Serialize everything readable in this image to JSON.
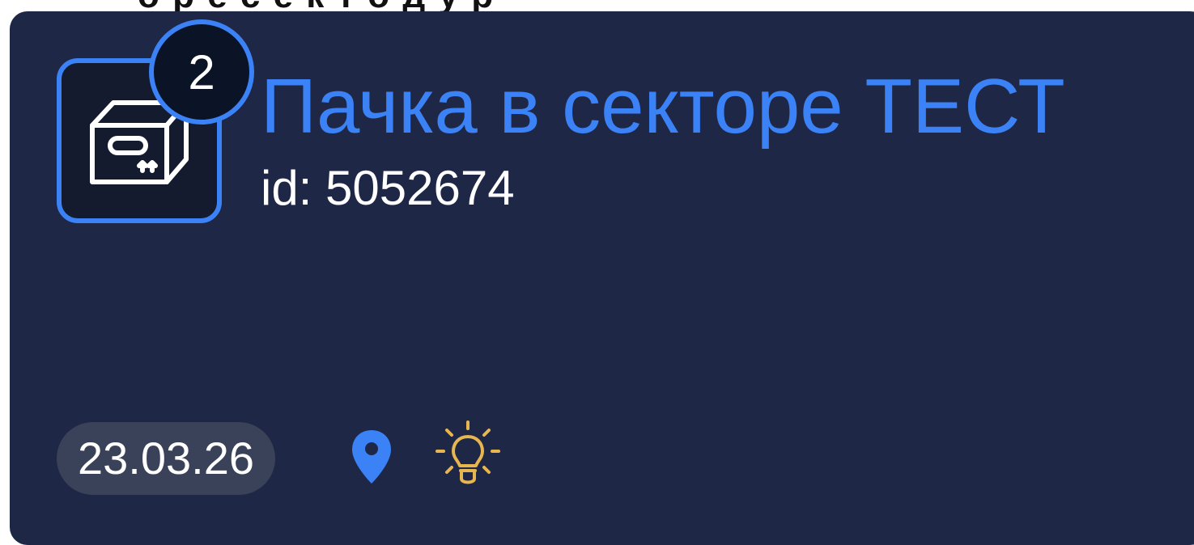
{
  "top_fragment": {
    "text": "о р е  с е к т о  д у р"
  },
  "card": {
    "badge_count": "2",
    "title": "Пачка в секторе ТЕСТ",
    "id_text": "id: 5052674",
    "date": "23.03.26",
    "icons": {
      "tile": "package-box-icon",
      "location": "location-pin-icon",
      "hint": "lightbulb-icon"
    },
    "colors": {
      "card_bg": "#1f2747",
      "accent": "#3b82f6",
      "hint_icon": "#e8b64f",
      "date_pill_bg": "#3a4259"
    }
  }
}
